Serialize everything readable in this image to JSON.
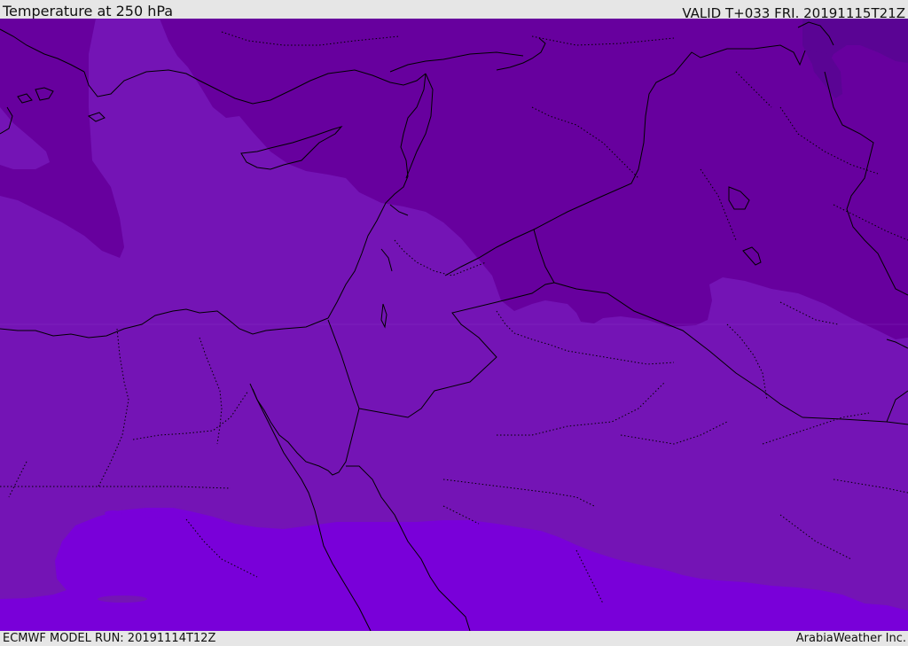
{
  "header": {
    "title": "Temperature at 250 hPa",
    "valid": "VALID T+033 FRI. 20191115T21Z"
  },
  "footer": {
    "model_run": "ECMWF MODEL RUN: 20191114T12Z",
    "credit": "ArabiaWeather Inc."
  },
  "map": {
    "field": "temperature",
    "level": "250 hPa",
    "colors": {
      "coldest": "#5a0494",
      "cold": "#67009e",
      "mid": "#7414b5",
      "warm": "#7900d9",
      "border": "#000000"
    }
  }
}
